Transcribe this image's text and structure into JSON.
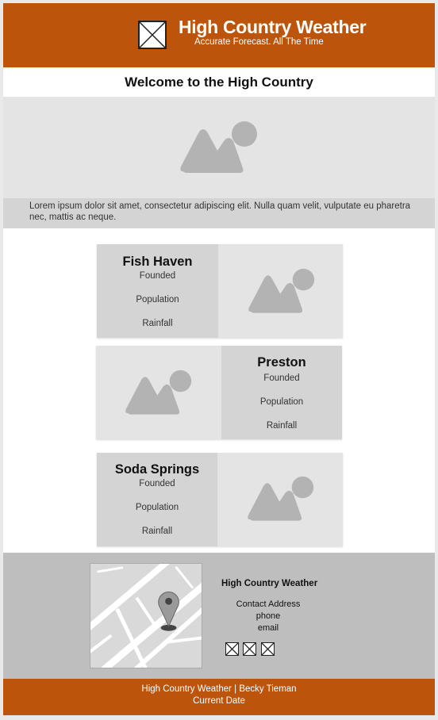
{
  "header": {
    "title": "High Country Weather",
    "tagline": "Accurate Forecast. All The Time",
    "logo_icon": "logo-placeholder-icon"
  },
  "welcome": "Welcome to the High Country",
  "hero": {
    "image_icon": "image-placeholder-icon",
    "text": "Lorem ipsum dolor sit amet, consectetur adipiscing elit. Nulla quam velit, vulputate eu pharetra nec, mattis ac neque."
  },
  "towns": [
    {
      "name": "Fish Haven",
      "founded": "Founded",
      "population": "Population",
      "rainfall": "Rainfall"
    },
    {
      "name": "Preston",
      "founded": "Founded",
      "population": "Population",
      "rainfall": "Rainfall"
    },
    {
      "name": "Soda Springs",
      "founded": "Founded",
      "population": "Population",
      "rainfall": "Rainfall"
    }
  ],
  "contact": {
    "map_icon": "map-pin-icon",
    "title": "High Country Weather",
    "address": "Contact Address",
    "phone": "phone",
    "email": "email",
    "social_icons": [
      "social-icon-1",
      "social-icon-2",
      "social-icon-3"
    ]
  },
  "footer": {
    "line1": "High Country Weather | Becky Tieman",
    "line2": "Current Date"
  },
  "colors": {
    "brand": "#bd540c",
    "placeholder_light": "#e4e4e4",
    "placeholder_dark": "#d4d4d4",
    "contact_bg": "#bebebe"
  }
}
